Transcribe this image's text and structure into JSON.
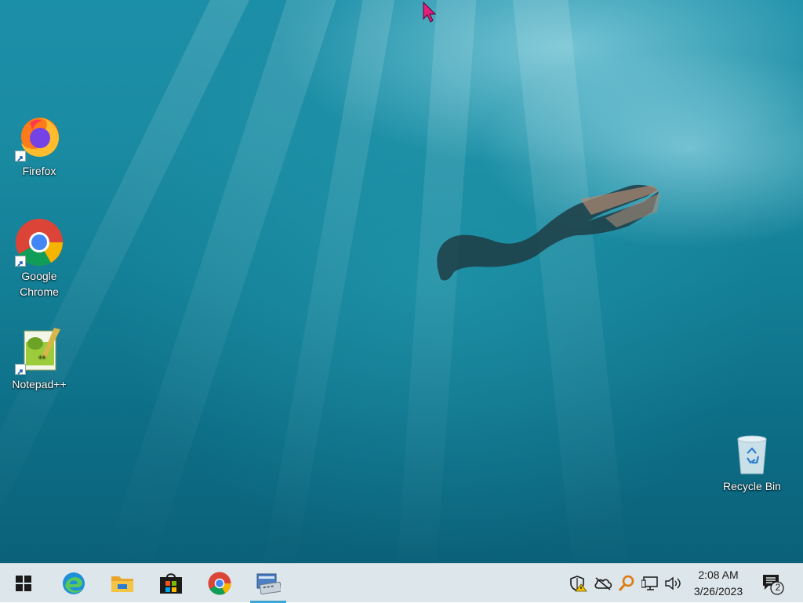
{
  "desktop": {
    "icons": [
      {
        "label": "Firefox",
        "icon": "firefox-icon"
      },
      {
        "label": "Google Chrome",
        "icon": "chrome-icon"
      },
      {
        "label": "Notepad++",
        "icon": "notepadpp-icon"
      },
      {
        "label": "Recycle Bin",
        "icon": "recycle-bin-icon"
      }
    ],
    "icon_labels": {
      "firefox": "Firefox",
      "chrome_line1": "Google",
      "chrome_line2": "Chrome",
      "notepadpp": "Notepad++",
      "recycle_bin": "Recycle Bin"
    }
  },
  "taskbar": {
    "pinned": [
      {
        "name": "Start",
        "icon": "windows-start-icon"
      },
      {
        "name": "Microsoft Edge",
        "icon": "edge-icon"
      },
      {
        "name": "File Explorer",
        "icon": "file-explorer-icon"
      },
      {
        "name": "Microsoft Store",
        "icon": "store-icon"
      },
      {
        "name": "Google Chrome",
        "icon": "chrome-icon"
      },
      {
        "name": "Remote Keyboard App",
        "icon": "keyboard-app-icon",
        "active": true
      }
    ],
    "tray": [
      {
        "icon": "security-shield-warning-icon"
      },
      {
        "icon": "onedrive-offline-icon"
      },
      {
        "icon": "search-key-icon"
      },
      {
        "icon": "network-monitor-icon"
      },
      {
        "icon": "volume-icon"
      }
    ],
    "clock": {
      "time": "2:08 AM",
      "date": "3/26/2023"
    },
    "notifications": {
      "count": "2",
      "icon": "action-center-icon"
    }
  },
  "colors": {
    "taskbar_bg": "#dde6ea",
    "active_indicator": "#3fa6d6",
    "cursor": "#e0207a"
  }
}
